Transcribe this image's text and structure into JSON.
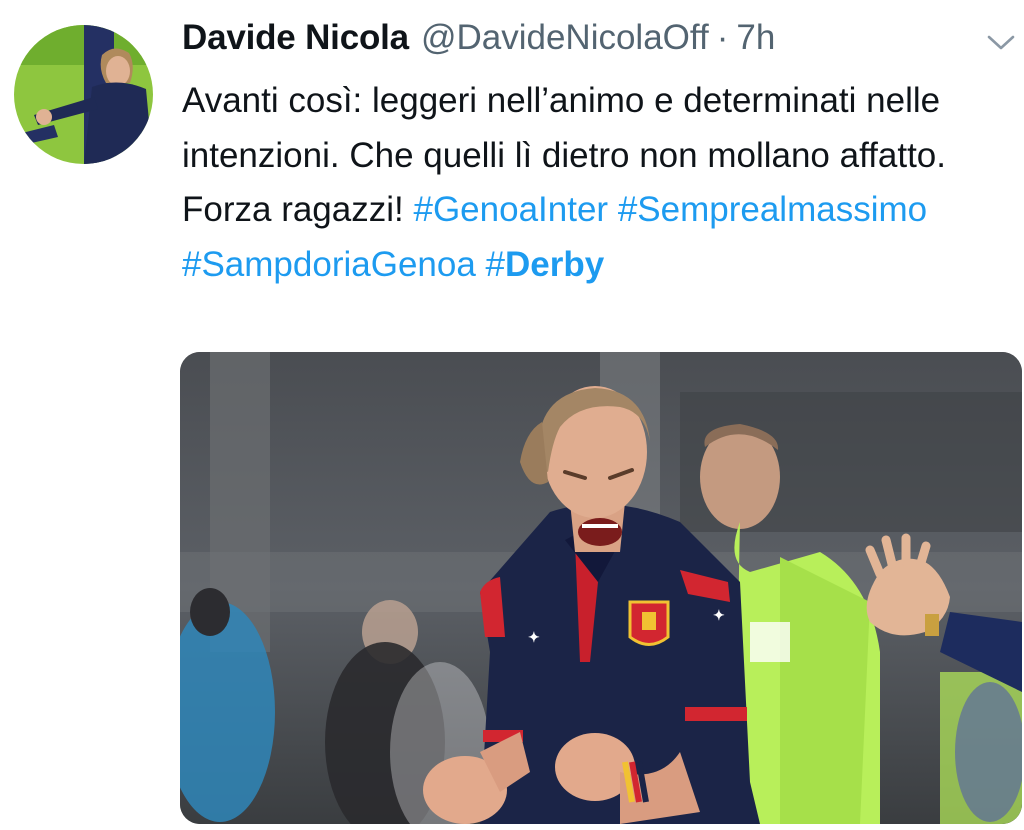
{
  "tweet": {
    "author_name": "Davide Nicola",
    "author_handle": "@DavideNicolaOff",
    "separator": "·",
    "timestamp": "7h",
    "text_plain": "Avanti così: leggeri nell’animo e determinati nelle intenzioni. Che quelli lì dietro non mollano affatto. Forza ragazzi!",
    "hashtags": [
      "#GenoaInter",
      "#Semprealmassimo",
      "#SampdoriaGenoa"
    ],
    "hashtag_bold_prefix": "#",
    "hashtag_bold_word": "Derby"
  },
  "icons": {
    "menu": "chevron-down-icon",
    "avatar": "avatar"
  },
  "colors": {
    "link": "#1d9bf0",
    "text": "#0f1419",
    "secondary": "#536471",
    "jersey_navy": "#1b2447",
    "jersey_red": "#d22630",
    "referee_green": "#b8ef5a"
  }
}
